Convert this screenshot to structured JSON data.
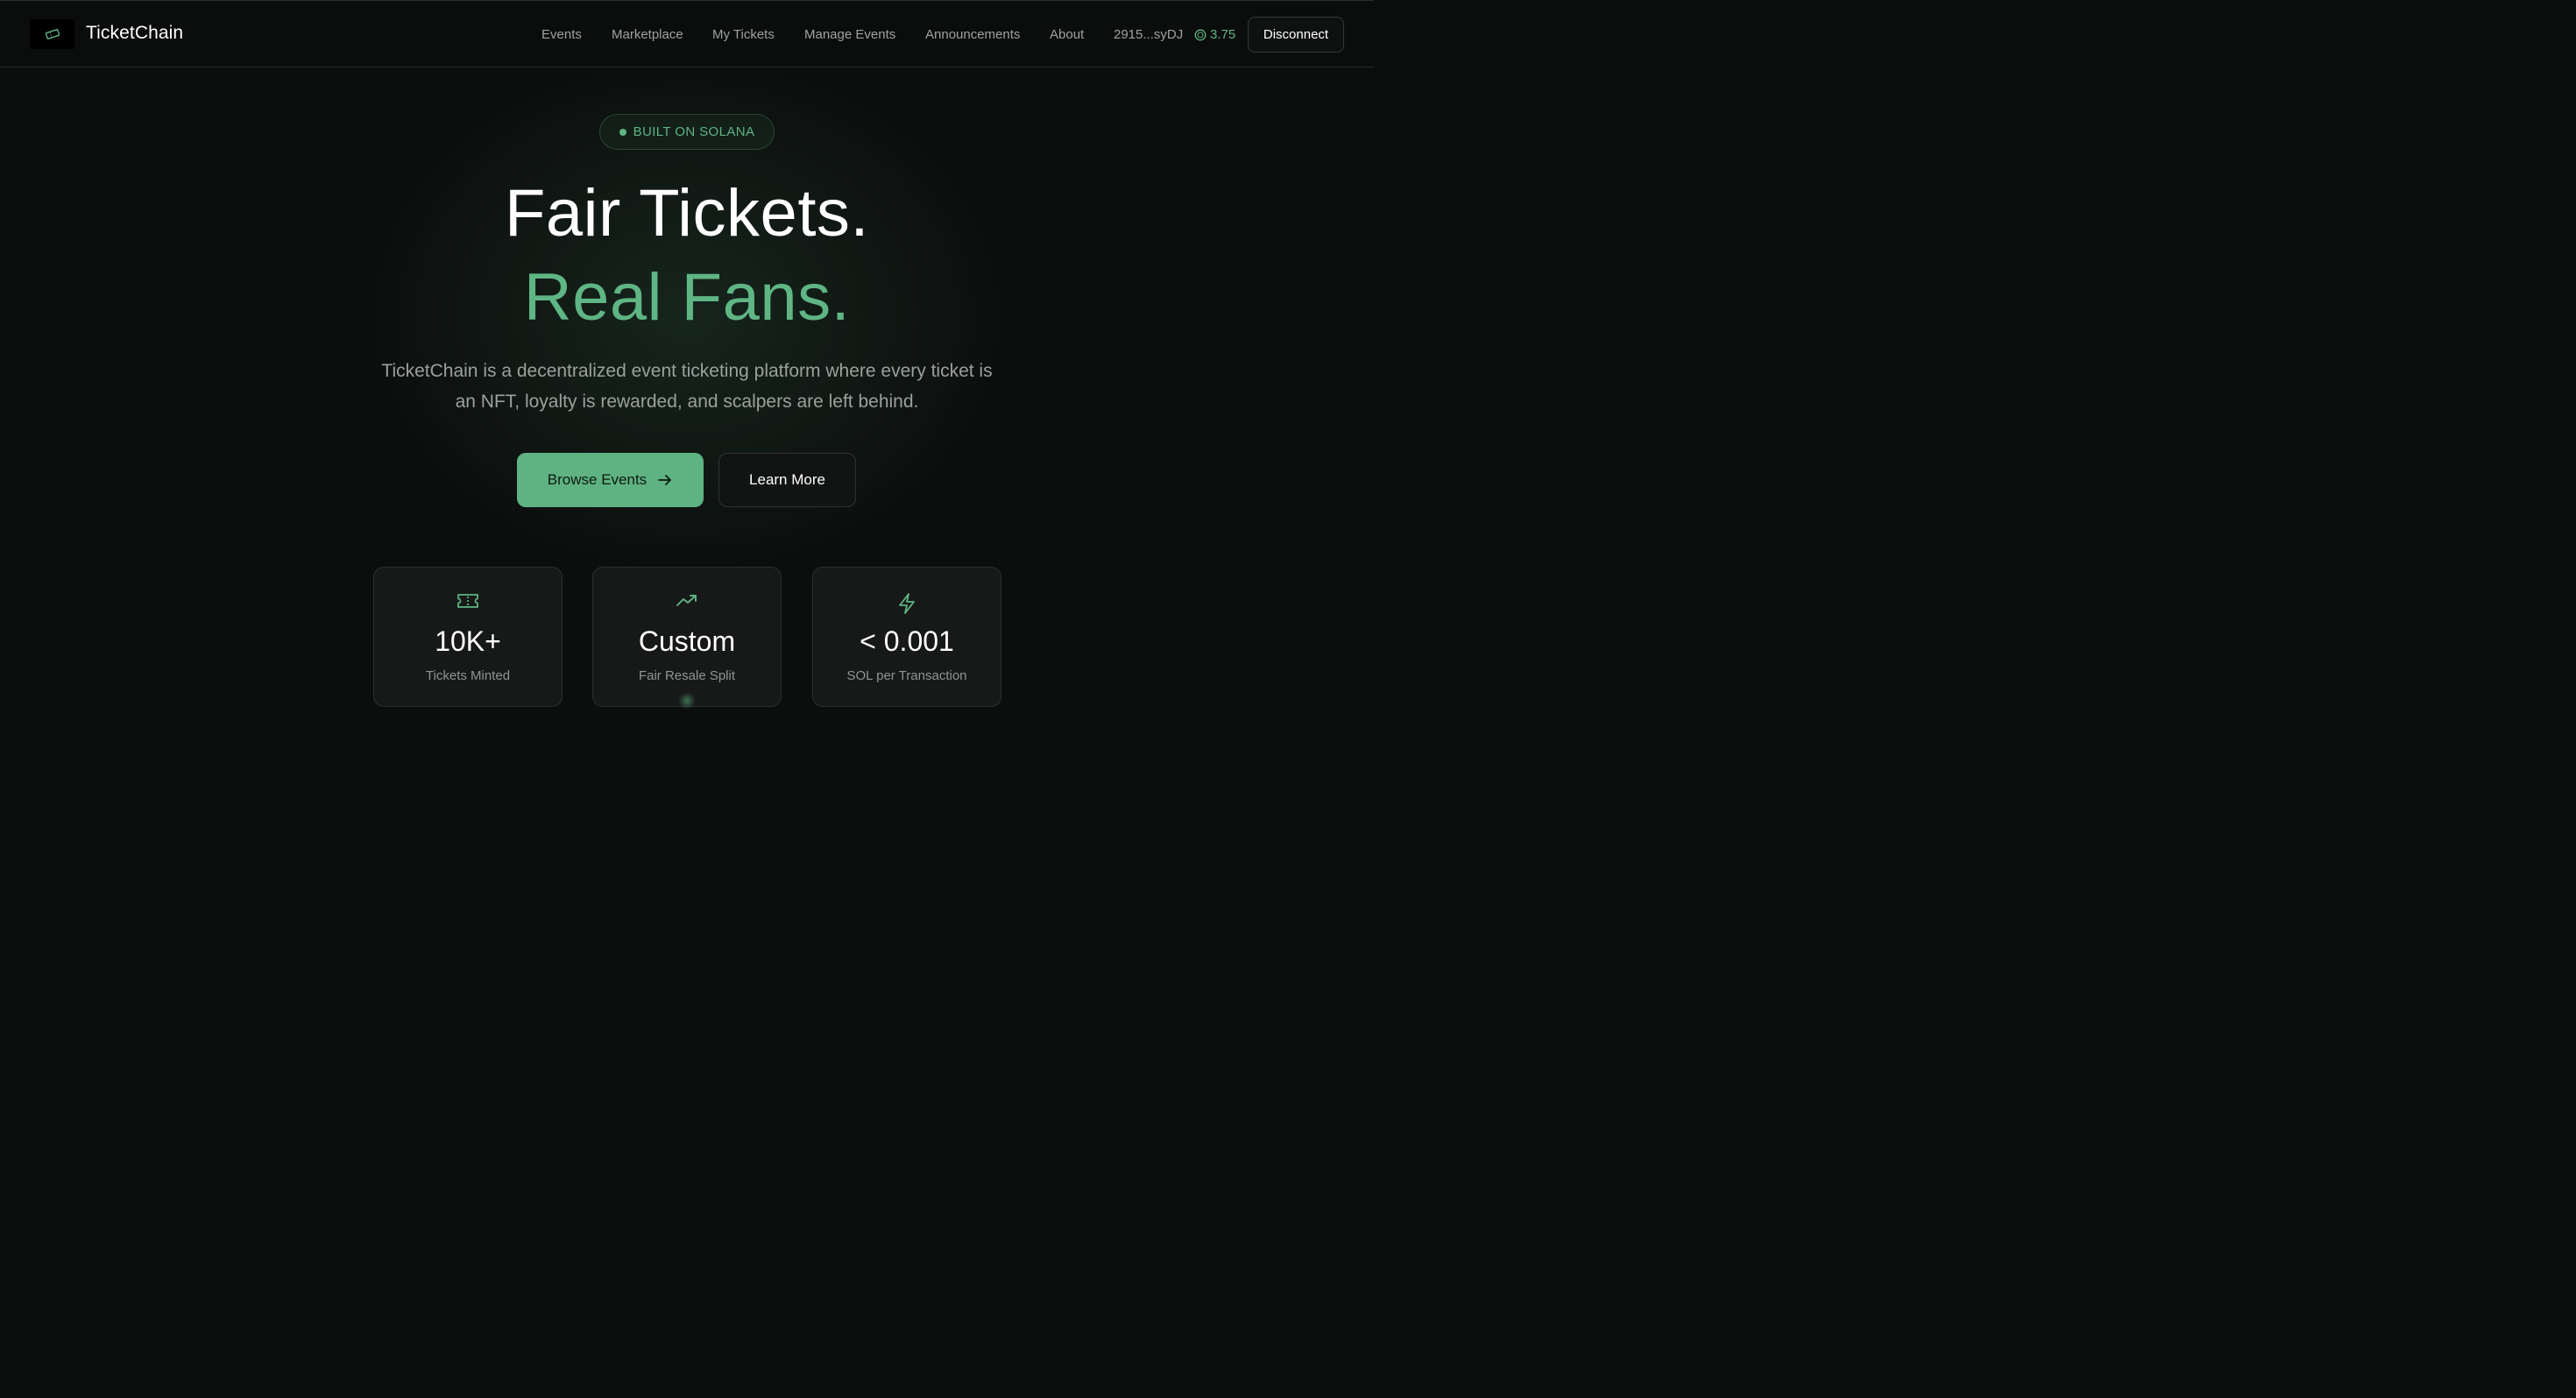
{
  "header": {
    "brand": "TicketChain",
    "nav": [
      "Events",
      "Marketplace",
      "My Tickets",
      "Manage Events",
      "Announcements",
      "About"
    ],
    "wallet_address": "2915...syDJ",
    "balance": "3.75",
    "disconnect_label": "Disconnect"
  },
  "hero": {
    "badge": "BUILT ON SOLANA",
    "title_line1": "Fair Tickets.",
    "title_line2": "Real Fans.",
    "lead_line1": "TicketChain is a decentralized event ticketing platform where every ticket is",
    "lead_line2": "an NFT, loyalty is rewarded, and scalpers are left behind.",
    "primary_cta": "Browse Events",
    "secondary_cta": "Learn More"
  },
  "stats": [
    {
      "icon": "ticket-icon",
      "value": "10K+",
      "label": "Tickets Minted"
    },
    {
      "icon": "trending-up-icon",
      "value": "Custom",
      "label": "Fair Resale Split"
    },
    {
      "icon": "lightning-icon",
      "value": "< 0.001",
      "label": "SOL per Transaction"
    }
  ],
  "colors": {
    "accent": "#5fb583",
    "background": "#0c0e0d",
    "card": "#161918",
    "muted_text": "#9aa19d"
  }
}
